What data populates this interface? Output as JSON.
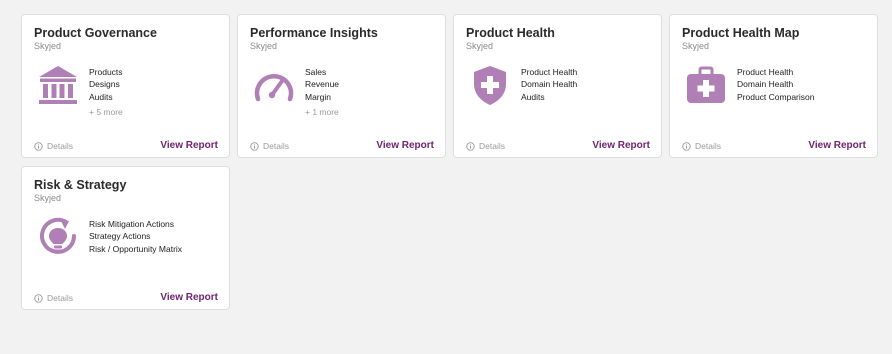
{
  "colors": {
    "background": "#f2f2f2",
    "card": "#ffffff",
    "icon": "#b07fb5",
    "link": "#6e2470"
  },
  "cards": [
    {
      "title": "Product Governance",
      "subtitle": "Skyjed",
      "icon": "bank-icon",
      "items": [
        "Products",
        "Designs",
        "Audits"
      ],
      "more": "+ 5 more",
      "details": "Details",
      "action": "View Report"
    },
    {
      "title": "Performance Insights",
      "subtitle": "Skyjed",
      "icon": "speedometer-icon",
      "items": [
        "Sales",
        "Revenue",
        "Margin"
      ],
      "more": "+ 1 more",
      "details": "Details",
      "action": "View Report"
    },
    {
      "title": "Product Health",
      "subtitle": "Skyjed",
      "icon": "shield-cross-icon",
      "items": [
        "Product Health",
        "Domain Health",
        "Audits"
      ],
      "details": "Details",
      "action": "View Report"
    },
    {
      "title": "Product Health Map",
      "subtitle": "Skyjed",
      "icon": "medical-kit-icon",
      "items": [
        "Product Health",
        "Domain Health",
        "Product Comparison"
      ],
      "details": "Details",
      "action": "View Report"
    },
    {
      "title": "Risk & Strategy",
      "subtitle": "Skyjed",
      "icon": "lightbulb-cycle-icon",
      "items": [
        "Risk Mitigation Actions",
        "Strategy Actions",
        "Risk / Opportunity Matrix"
      ],
      "details": "Details",
      "action": "View Report"
    }
  ]
}
